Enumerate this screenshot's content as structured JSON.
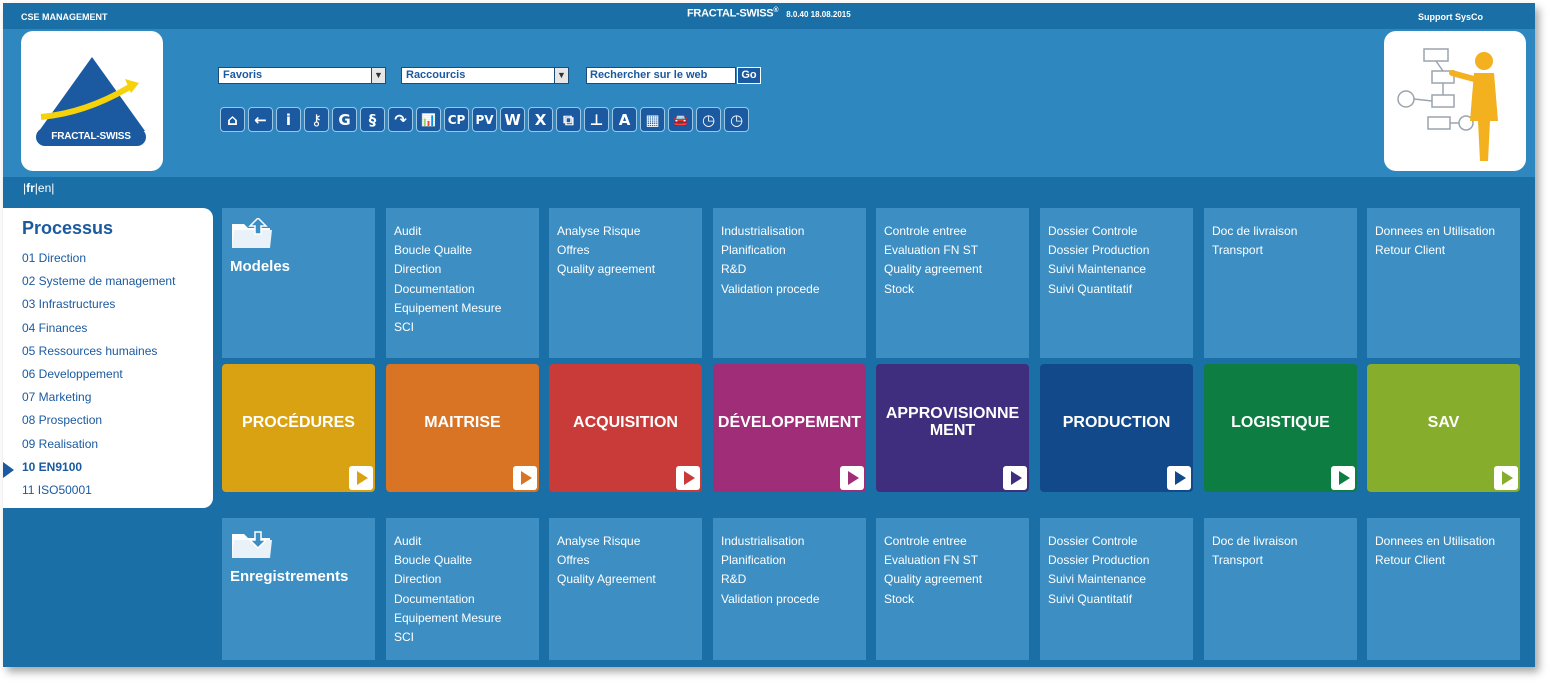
{
  "topbar": {
    "app_name": "CSE MANAGEMENT",
    "brand": "FRACTAL-SWISS",
    "brand_mark": "®",
    "version": "8.0.40 18.08.2015",
    "support": "Support SysCo"
  },
  "logo": {
    "text": "FRACTAL-SWISS"
  },
  "header": {
    "favoris": "Favoris",
    "raccourcis": "Raccourcis",
    "search_label": "Rechercher sur le web",
    "go": "Go"
  },
  "toolbar": [
    {
      "icon": "home-icon",
      "glyph": "⌂"
    },
    {
      "icon": "back-arrow-icon",
      "glyph": "←"
    },
    {
      "icon": "info-icon",
      "glyph": "i"
    },
    {
      "icon": "key-icon",
      "glyph": "⚷"
    },
    {
      "icon": "g-icon",
      "glyph": "G"
    },
    {
      "icon": "paragraph-icon",
      "glyph": "§"
    },
    {
      "icon": "curve-icon",
      "glyph": "↷"
    },
    {
      "icon": "bar-chart-icon",
      "glyph": "📊"
    },
    {
      "icon": "cp-icon",
      "glyph": "CP"
    },
    {
      "icon": "pv-icon",
      "glyph": "PV"
    },
    {
      "icon": "word-icon",
      "glyph": "W"
    },
    {
      "icon": "excel-icon",
      "glyph": "X"
    },
    {
      "icon": "copy-icon",
      "glyph": "⧉"
    },
    {
      "icon": "org-chart-icon",
      "glyph": "⊥"
    },
    {
      "icon": "font-a-icon",
      "glyph": "A"
    },
    {
      "icon": "calculator-icon",
      "glyph": "▦"
    },
    {
      "icon": "car-icon",
      "glyph": "🚘"
    },
    {
      "icon": "clock-icon",
      "glyph": "◷"
    },
    {
      "icon": "clock-alt-icon",
      "glyph": "◷"
    }
  ],
  "lang": {
    "fr": "fr",
    "en": "en"
  },
  "sidebar": {
    "title": "Processus",
    "items": [
      "01 Direction",
      "02 Systeme de management",
      "03 Infrastructures",
      "04 Finances",
      "05 Ressources humaines",
      "06 Developpement",
      "07 Marketing",
      "08 Prospection",
      "09 Realisation",
      "10 EN9100",
      "11 ISO50001"
    ],
    "active_index": 9
  },
  "rows": {
    "modeles_label": "Modeles",
    "enregistrements_label": "Enregistrements"
  },
  "columns": [
    {
      "tile": "PROCÉDURES",
      "color": "#d9a212",
      "play_color": "#d9a212",
      "top": [],
      "bottom": []
    },
    {
      "tile": "MAITRISE",
      "color": "#d87424",
      "play_color": "#d87424",
      "top": [
        "Audit",
        "Boucle Qualite",
        "Direction",
        "Documentation",
        "Equipement Mesure",
        "SCI"
      ],
      "bottom": [
        "Audit",
        "Boucle Qualite",
        "Direction",
        "Documentation",
        "Equipement Mesure",
        "SCI"
      ]
    },
    {
      "tile": "ACQUISITION",
      "color": "#c83b38",
      "play_color": "#c83b38",
      "top": [
        "Analyse Risque",
        "Offres",
        "Quality agreement"
      ],
      "bottom": [
        "Analyse Risque",
        "Offres",
        "Quality Agreement"
      ]
    },
    {
      "tile": "DÉVELOPPEMENT",
      "color": "#a02d77",
      "play_color": "#a02d77",
      "top": [
        "Industrialisation",
        "Planification",
        "R&D",
        "Validation procede"
      ],
      "bottom": [
        "Industrialisation",
        "Planification",
        "R&D",
        "Validation procede"
      ]
    },
    {
      "tile": "APPROVISIONNEMENT",
      "tile_lines": [
        "APPROVISIONNE",
        "MENT"
      ],
      "color": "#3f2e7d",
      "play_color": "#3f2e7d",
      "top": [
        "Controle entree",
        "Evaluation FN ST",
        "Quality agreement",
        "Stock"
      ],
      "bottom": [
        "Controle entree",
        "Evaluation FN ST",
        "Quality agreement",
        "Stock"
      ]
    },
    {
      "tile": "PRODUCTION",
      "color": "#12498a",
      "play_color": "#12498a",
      "top": [
        "Dossier Controle",
        "Dossier Production",
        "Suivi Maintenance",
        "Suivi Quantitatif"
      ],
      "bottom": [
        "Dossier Controle",
        "Dossier Production",
        "Suivi Maintenance",
        "Suivi Quantitatif"
      ]
    },
    {
      "tile": "LOGISTIQUE",
      "color": "#0d7d42",
      "play_color": "#0d7d42",
      "top": [
        "Doc de livraison",
        "Transport"
      ],
      "bottom": [
        "Doc de livraison",
        "Transport"
      ]
    },
    {
      "tile": "SAV",
      "color": "#86ad2c",
      "play_color": "#86ad2c",
      "top": [
        "Donnees en Utilisation",
        "Retour Client"
      ],
      "bottom": [
        "Donnees en Utilisation",
        "Retour Client"
      ]
    }
  ]
}
